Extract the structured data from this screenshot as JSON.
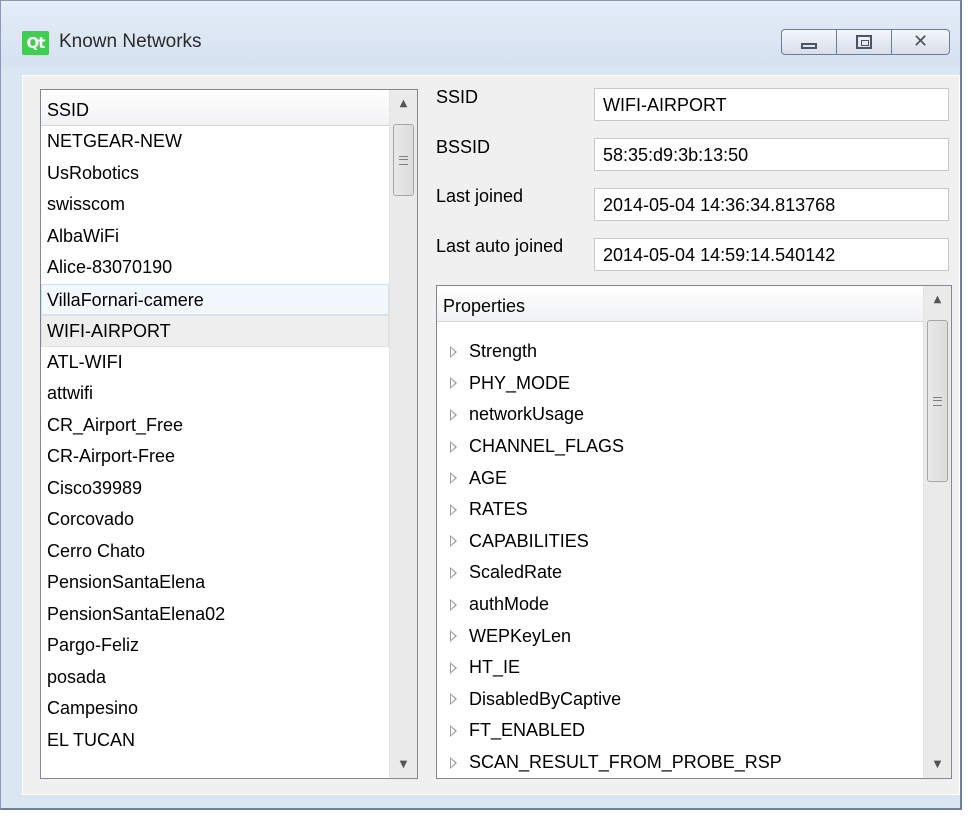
{
  "window": {
    "title": "Known Networks",
    "logo_text": "Qt"
  },
  "list": {
    "header": "SSID",
    "items": [
      "NETGEAR-NEW",
      "UsRobotics",
      "swisscom",
      "AlbaWiFi",
      "Alice-83070190",
      "VillaFornari-camere",
      "WIFI-AIRPORT",
      "ATL-WIFI",
      "attwifi",
      "CR_Airport_Free",
      "CR-Airport-Free",
      "Cisco39989",
      "Corcovado",
      "Cerro Chato",
      "PensionSantaElena",
      "PensionSantaElena02",
      "Pargo-Feliz",
      "posada",
      "Campesino",
      "EL TUCAN"
    ],
    "hover_index": 5,
    "selected_index": 6
  },
  "details": {
    "ssid_label": "SSID",
    "ssid_value": "WIFI-AIRPORT",
    "bssid_label": "BSSID",
    "bssid_value": "58:35:d9:3b:13:50",
    "last_joined_label": "Last joined",
    "last_joined_value": "2014-05-04 14:36:34.813768",
    "last_auto_joined_label": "Last auto joined",
    "last_auto_joined_value": "2014-05-04 14:59:14.540142"
  },
  "properties": {
    "header": "Properties",
    "items": [
      "Strength",
      "PHY_MODE",
      "networkUsage",
      "CHANNEL_FLAGS",
      "AGE",
      "RATES",
      "CAPABILITIES",
      "ScaledRate",
      "authMode",
      "WEPKeyLen",
      "HT_IE",
      "DisabledByCaptive",
      "FT_ENABLED",
      "SCAN_RESULT_FROM_PROBE_RSP"
    ]
  },
  "colors": {
    "qt_green": "#41cd52",
    "frame": "#dbe6f3",
    "selected_row": "#eeeeee",
    "hover_row": "#f3f8fd"
  },
  "icons": [
    "qt-logo-icon",
    "minimize-icon",
    "maximize-icon",
    "close-icon",
    "scroll-up-arrow-icon",
    "scroll-down-arrow-icon",
    "tree-expand-arrow-icon"
  ]
}
